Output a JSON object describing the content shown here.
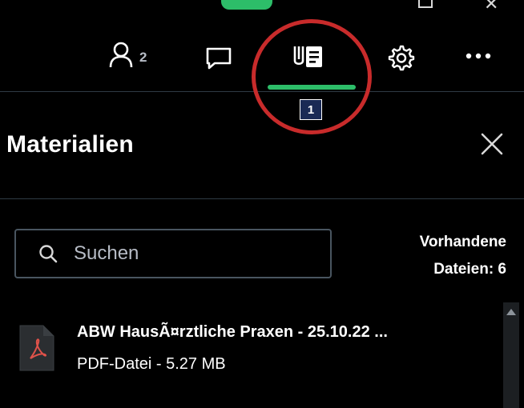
{
  "toolbar": {
    "participants_count": "2",
    "icons": [
      "user-icon",
      "chat-icon",
      "materials-icon",
      "gear-icon",
      "more-icon"
    ],
    "active_tab": "materials"
  },
  "annotation": {
    "badge_label": "1"
  },
  "panel": {
    "title": "Materialien",
    "close_icon": "close-icon"
  },
  "search": {
    "value": "",
    "placeholder": "Suchen"
  },
  "files_summary": {
    "line1": "Vorhandene",
    "line2": "Dateien: 6"
  },
  "files": [
    {
      "name": "ABW HausÃ¤rztliche Praxen - 25.10.22 ...",
      "meta": "PDF-Datei - 5.27 MB",
      "icon": "pdf-icon"
    }
  ],
  "colors": {
    "accent": "#2dbd69",
    "highlight_ring": "#c82b2b",
    "background": "#000000",
    "muted_text": "#b7bcc6",
    "pdf_red": "#e0524a"
  }
}
